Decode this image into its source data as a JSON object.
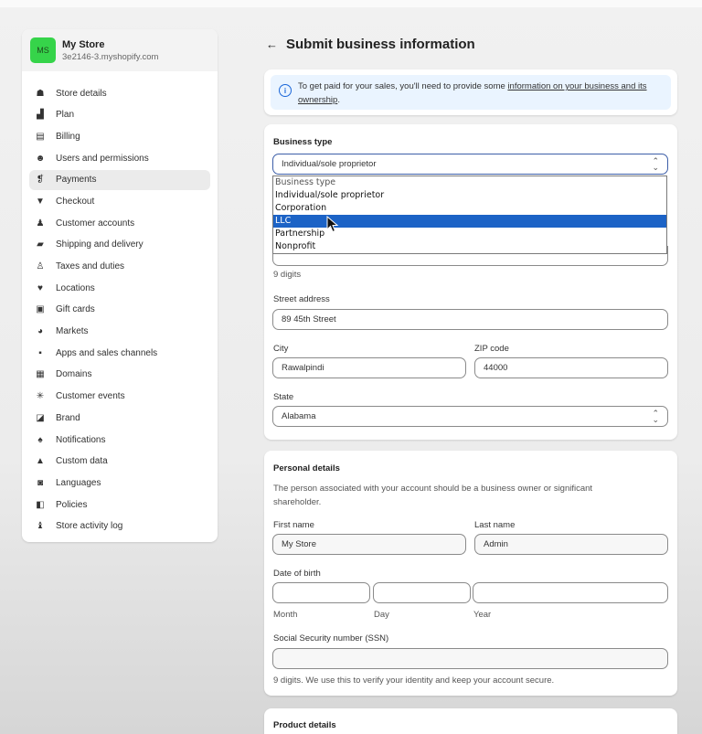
{
  "store": {
    "initials": "MS",
    "name": "My Store",
    "domain": "3e2146-3.myshopify.com"
  },
  "sidebar": {
    "items": [
      {
        "label": "Store details",
        "icon": "store-icon",
        "glyph": "☗"
      },
      {
        "label": "Plan",
        "icon": "plan-icon",
        "glyph": "▟"
      },
      {
        "label": "Billing",
        "icon": "billing-icon",
        "glyph": "▤"
      },
      {
        "label": "Users and permissions",
        "icon": "users-icon",
        "glyph": "☻"
      },
      {
        "label": "Payments",
        "icon": "payments-icon",
        "glyph": "❡",
        "active": true
      },
      {
        "label": "Checkout",
        "icon": "checkout-icon",
        "glyph": "▼"
      },
      {
        "label": "Customer accounts",
        "icon": "customer-icon",
        "glyph": "♟"
      },
      {
        "label": "Shipping and delivery",
        "icon": "truck-icon",
        "glyph": "▰"
      },
      {
        "label": "Taxes and duties",
        "icon": "taxes-icon",
        "glyph": "♙"
      },
      {
        "label": "Locations",
        "icon": "location-icon",
        "glyph": "♥"
      },
      {
        "label": "Gift cards",
        "icon": "gift-card-icon",
        "glyph": "▣"
      },
      {
        "label": "Markets",
        "icon": "globe-icon",
        "glyph": "◕"
      },
      {
        "label": "Apps and sales channels",
        "icon": "apps-icon",
        "glyph": "▪"
      },
      {
        "label": "Domains",
        "icon": "domains-icon",
        "glyph": "▦"
      },
      {
        "label": "Customer events",
        "icon": "events-icon",
        "glyph": "✳"
      },
      {
        "label": "Brand",
        "icon": "brand-icon",
        "glyph": "◪"
      },
      {
        "label": "Notifications",
        "icon": "bell-icon",
        "glyph": "♠"
      },
      {
        "label": "Custom data",
        "icon": "custom-data-icon",
        "glyph": "▲"
      },
      {
        "label": "Languages",
        "icon": "languages-icon",
        "glyph": "◙"
      },
      {
        "label": "Policies",
        "icon": "policies-icon",
        "glyph": "◧"
      },
      {
        "label": "Store activity log",
        "icon": "activity-log-icon",
        "glyph": "♝"
      }
    ]
  },
  "page": {
    "title": "Submit business information"
  },
  "banner": {
    "text": "To get paid for your sales, you'll need to provide some ",
    "link": "information on your business and its ownership",
    "end": "."
  },
  "business": {
    "type_label": "Business type",
    "type_value": "Individual/sole proprietor",
    "dropdown_options": [
      "Business type",
      "Individual/sole proprietor",
      "Corporation",
      "LLC",
      "Partnership",
      "Nonprofit"
    ],
    "selected_option": "LLC",
    "digits_help": "9 digits",
    "street_label": "Street address",
    "street_value": "89 45th Street",
    "city_label": "City",
    "city_value": "Rawalpindi",
    "zip_label": "ZIP code",
    "zip_value": "44000",
    "state_label": "State",
    "state_value": "Alabama"
  },
  "personal": {
    "title": "Personal details",
    "desc": "The person associated with your account should be a business owner or significant shareholder.",
    "first_label": "First name",
    "first_value": "My Store",
    "last_label": "Last name",
    "last_value": "Admin",
    "dob_label": "Date of birth",
    "month_label": "Month",
    "day_label": "Day",
    "year_label": "Year",
    "ssn_label": "Social Security number (SSN)",
    "ssn_help": "9 digits. We use this to verify your identity and keep your account secure."
  },
  "product": {
    "title": "Product details"
  }
}
